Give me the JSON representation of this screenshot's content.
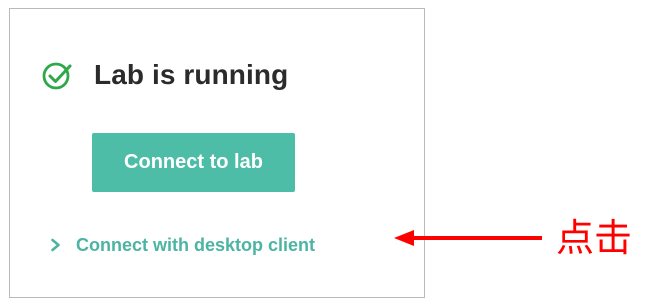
{
  "status": {
    "icon": "check-circle-icon",
    "title": "Lab is running",
    "color": "#2ea84a"
  },
  "connect_button": {
    "label": "Connect to lab",
    "color": "#4dbda7"
  },
  "desktop_link": {
    "icon": "chevron-right-icon",
    "label": "Connect with desktop client",
    "color": "#4bb4a3"
  },
  "annotation": {
    "icon": "arrow-left-icon",
    "text": "点击",
    "color": "#ff0000"
  }
}
